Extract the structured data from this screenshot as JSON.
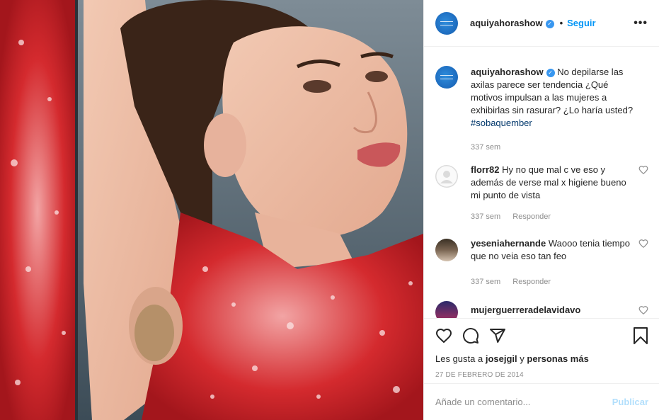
{
  "header": {
    "username": "aquiyahorashow",
    "verified_icon": "verified-badge-icon",
    "separator": "•",
    "follow_label": "Seguir",
    "more_icon": "more-options-icon",
    "more_label": "•••"
  },
  "caption": {
    "username": "aquiyahorashow",
    "text": "No depilarse las axilas parece ser tendencia ¿Qué motivos impulsan a las mujeres a exhibirlas sin rasurar? ¿Lo haría usted?",
    "hashtag": "#sobaquember",
    "time": "337 sem"
  },
  "comments": [
    {
      "username": "florr82",
      "text": "Hy no que mal c ve eso y además de verse mal x higiene bueno mi punto de vista",
      "time": "337 sem",
      "reply_label": "Responder"
    },
    {
      "username": "yeseniahernande",
      "text": "Waooo tenia tiempo que no veia eso tan feo",
      "time": "337 sem",
      "reply_label": "Responder"
    },
    {
      "username": "mujerguerreradelavidavo",
      "text": "",
      "time": "",
      "reply_label": ""
    }
  ],
  "actions": {
    "icons": [
      "heart-icon",
      "comment-icon",
      "share-icon",
      "bookmark-icon"
    ],
    "likes_prefix": "Les gusta a",
    "likes_user": "josejgil",
    "likes_join": "y",
    "likes_others": "personas más",
    "date": "27 DE FEBRERO DE 2014"
  },
  "add_comment": {
    "placeholder": "Añade un comentario...",
    "publish_label": "Publicar"
  },
  "colors": {
    "accent": "#0095f6",
    "verified": "#3897f0",
    "publish_disabled": "#b2dffc",
    "dress": "#d42a2e",
    "background_photo": "#6b7a86"
  }
}
